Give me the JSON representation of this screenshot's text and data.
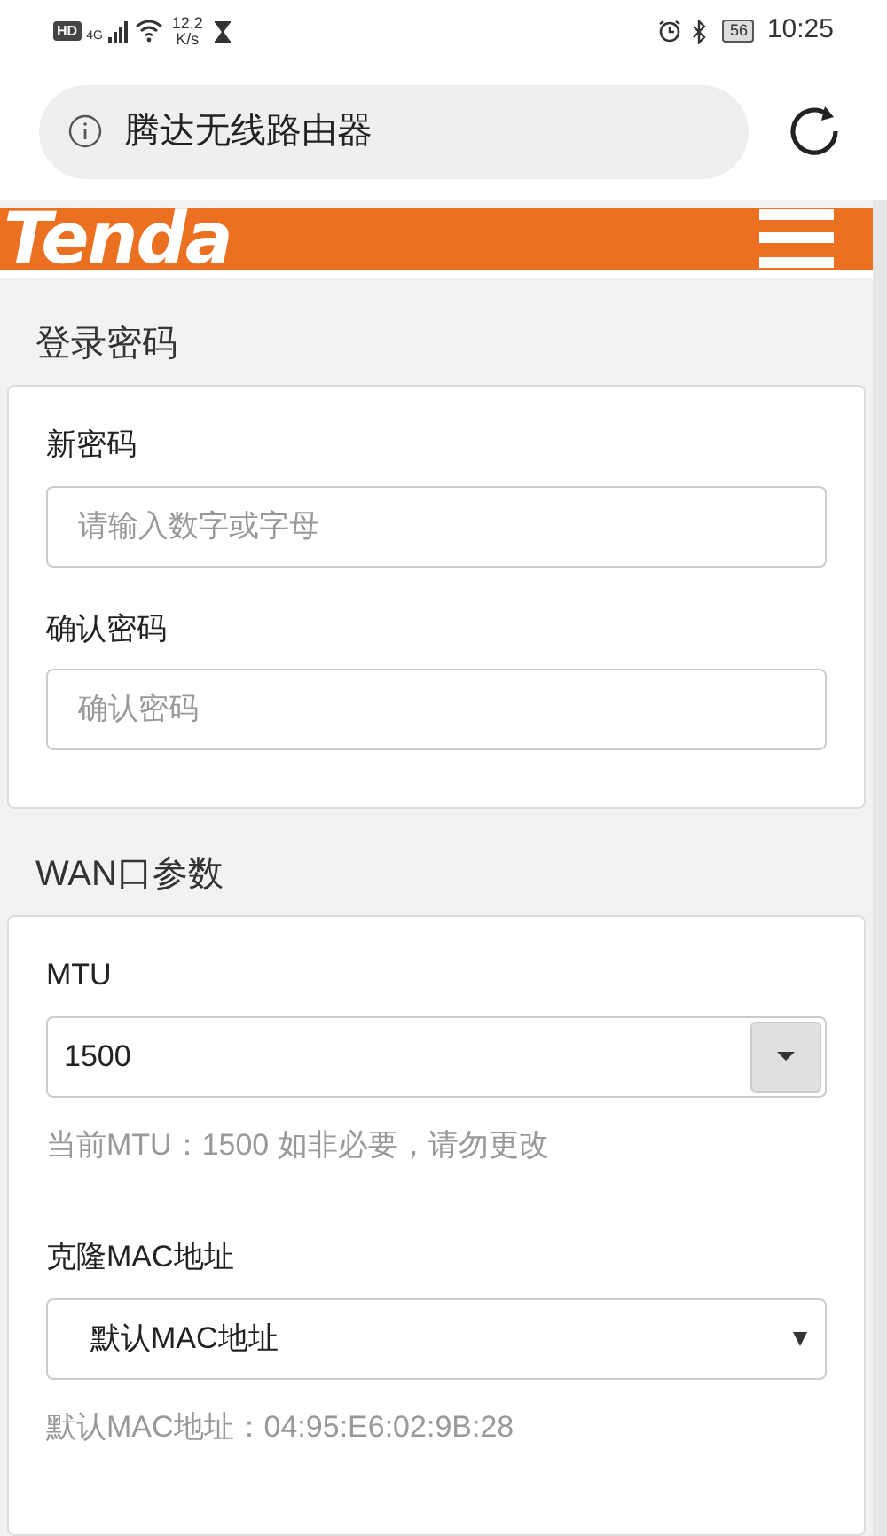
{
  "status_bar": {
    "hd": "HD",
    "network": "4G",
    "speed_value": "12.2",
    "speed_unit": "K/s",
    "battery": "56",
    "time": "10:25"
  },
  "address_bar": {
    "title": "腾达无线路由器"
  },
  "header": {
    "logo": "Tenda"
  },
  "sections": [
    {
      "title": "登录密码",
      "fields": [
        {
          "kind": "input",
          "label": "新密码",
          "placeholder": "请输入数字或字母"
        },
        {
          "kind": "input",
          "label": "确认密码",
          "placeholder": "确认密码"
        }
      ]
    },
    {
      "title": "WAN口参数",
      "fields": [
        {
          "kind": "combo",
          "label": "MTU",
          "value": "1500",
          "help": "当前MTU：1500 如非必要，请勿更改"
        },
        {
          "kind": "select",
          "label": "克隆MAC地址",
          "value": "默认MAC地址",
          "help": "默认MAC地址：04:95:E6:02:9B:28"
        }
      ]
    }
  ]
}
